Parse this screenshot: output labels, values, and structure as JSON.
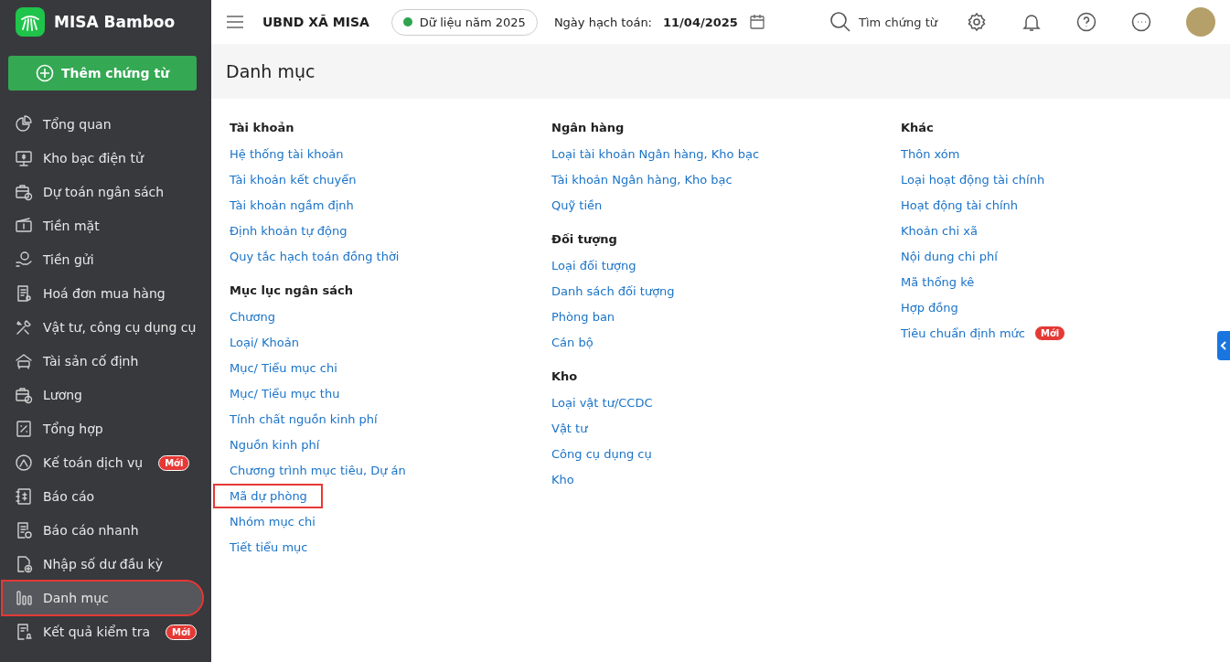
{
  "app": {
    "name": "MISA Bamboo"
  },
  "add_button": {
    "label": "Thêm chứng từ"
  },
  "header": {
    "organization": "UBND XÃ MISA",
    "data_year": {
      "label": "Dữ liệu năm 2025",
      "color": "#2ea44f"
    },
    "date_label": "Ngày hạch toán:",
    "date_value": "11/04/2025",
    "search_label": "Tìm chứng từ"
  },
  "sidebar": {
    "items": [
      {
        "label": "Tổng quan",
        "selected": false,
        "highlighted": false
      },
      {
        "label": "Kho bạc điện tử",
        "selected": false,
        "highlighted": false
      },
      {
        "label": "Dự toán ngân sách",
        "selected": false,
        "highlighted": false
      },
      {
        "label": "Tiền mặt",
        "selected": false,
        "highlighted": false
      },
      {
        "label": "Tiền gửi",
        "selected": false,
        "highlighted": false
      },
      {
        "label": "Hoá đơn mua hàng",
        "selected": false,
        "highlighted": false
      },
      {
        "label": "Vật tư, công cụ dụng cụ",
        "selected": false,
        "highlighted": false
      },
      {
        "label": "Tài sản cố định",
        "selected": false,
        "highlighted": false
      },
      {
        "label": "Lương",
        "selected": false,
        "highlighted": false
      },
      {
        "label": "Tổng hợp",
        "selected": false,
        "highlighted": false
      },
      {
        "label": "Kế toán dịch vụ",
        "selected": false,
        "highlighted": false,
        "badge": "Mới"
      },
      {
        "label": "Báo cáo",
        "selected": false,
        "highlighted": false
      },
      {
        "label": "Báo cáo nhanh",
        "selected": false,
        "highlighted": false
      },
      {
        "label": "Nhập số dư đầu kỳ",
        "selected": false,
        "highlighted": false
      },
      {
        "label": "Danh mục",
        "selected": true,
        "highlighted": true
      },
      {
        "label": "Kết quả kiểm tra",
        "selected": false,
        "highlighted": false,
        "badge": "Mới"
      }
    ]
  },
  "page": {
    "title": "Danh mục"
  },
  "columns": [
    {
      "sections": [
        {
          "heading": "Tài khoản",
          "items": [
            {
              "label": "Hệ thống tài khoản",
              "highlighted": false
            },
            {
              "label": "Tài khoản kết chuyển",
              "highlighted": false
            },
            {
              "label": "Tài khoản ngầm định",
              "highlighted": false
            },
            {
              "label": "Định khoản tự động",
              "highlighted": false
            },
            {
              "label": "Quy tắc hạch toán đồng thời",
              "highlighted": false
            }
          ]
        },
        {
          "heading": "Mục lục ngân sách",
          "items": [
            {
              "label": "Chương",
              "highlighted": false
            },
            {
              "label": "Loại/ Khoản",
              "highlighted": false
            },
            {
              "label": "Mục/ Tiểu mục chi",
              "highlighted": false
            },
            {
              "label": "Mục/ Tiểu mục thu",
              "highlighted": false
            },
            {
              "label": "Tính chất nguồn kinh phí",
              "highlighted": false
            },
            {
              "label": "Nguồn kinh phí",
              "highlighted": false
            },
            {
              "label": "Chương trình mục tiêu, Dự án",
              "highlighted": false
            },
            {
              "label": "Mã dự phòng",
              "highlighted": true
            },
            {
              "label": "Nhóm mục chi",
              "highlighted": false
            },
            {
              "label": "Tiết tiểu mục",
              "highlighted": false
            }
          ]
        }
      ]
    },
    {
      "sections": [
        {
          "heading": "Ngân hàng",
          "items": [
            {
              "label": "Loại tài khoản Ngân hàng, Kho bạc",
              "highlighted": false
            },
            {
              "label": "Tài khoản Ngân hàng, Kho bạc",
              "highlighted": false
            },
            {
              "label": "Quỹ tiền",
              "highlighted": false
            }
          ]
        },
        {
          "heading": "Đối tượng",
          "items": [
            {
              "label": "Loại đối tượng",
              "highlighted": false
            },
            {
              "label": "Danh sách đối tượng",
              "highlighted": false
            },
            {
              "label": "Phòng ban",
              "highlighted": false
            },
            {
              "label": "Cán bộ",
              "highlighted": false
            }
          ]
        },
        {
          "heading": "Kho",
          "items": [
            {
              "label": "Loại vật tư/CCDC",
              "highlighted": false
            },
            {
              "label": "Vật tư",
              "highlighted": false
            },
            {
              "label": "Công cụ dụng cụ",
              "highlighted": false
            },
            {
              "label": "Kho",
              "highlighted": false
            }
          ]
        }
      ]
    },
    {
      "sections": [
        {
          "heading": "Khác",
          "items": [
            {
              "label": "Thôn xóm",
              "highlighted": false
            },
            {
              "label": "Loại hoạt động tài chính",
              "highlighted": false
            },
            {
              "label": "Hoạt động tài chính",
              "highlighted": false
            },
            {
              "label": "Khoản chi xã",
              "highlighted": false
            },
            {
              "label": "Nội dung chi phí",
              "highlighted": false
            },
            {
              "label": "Mã thống kê",
              "highlighted": false
            },
            {
              "label": "Hợp đồng",
              "highlighted": false
            },
            {
              "label": "Tiêu chuẩn định mức",
              "highlighted": false,
              "badge": "Mới"
            }
          ]
        }
      ]
    }
  ]
}
